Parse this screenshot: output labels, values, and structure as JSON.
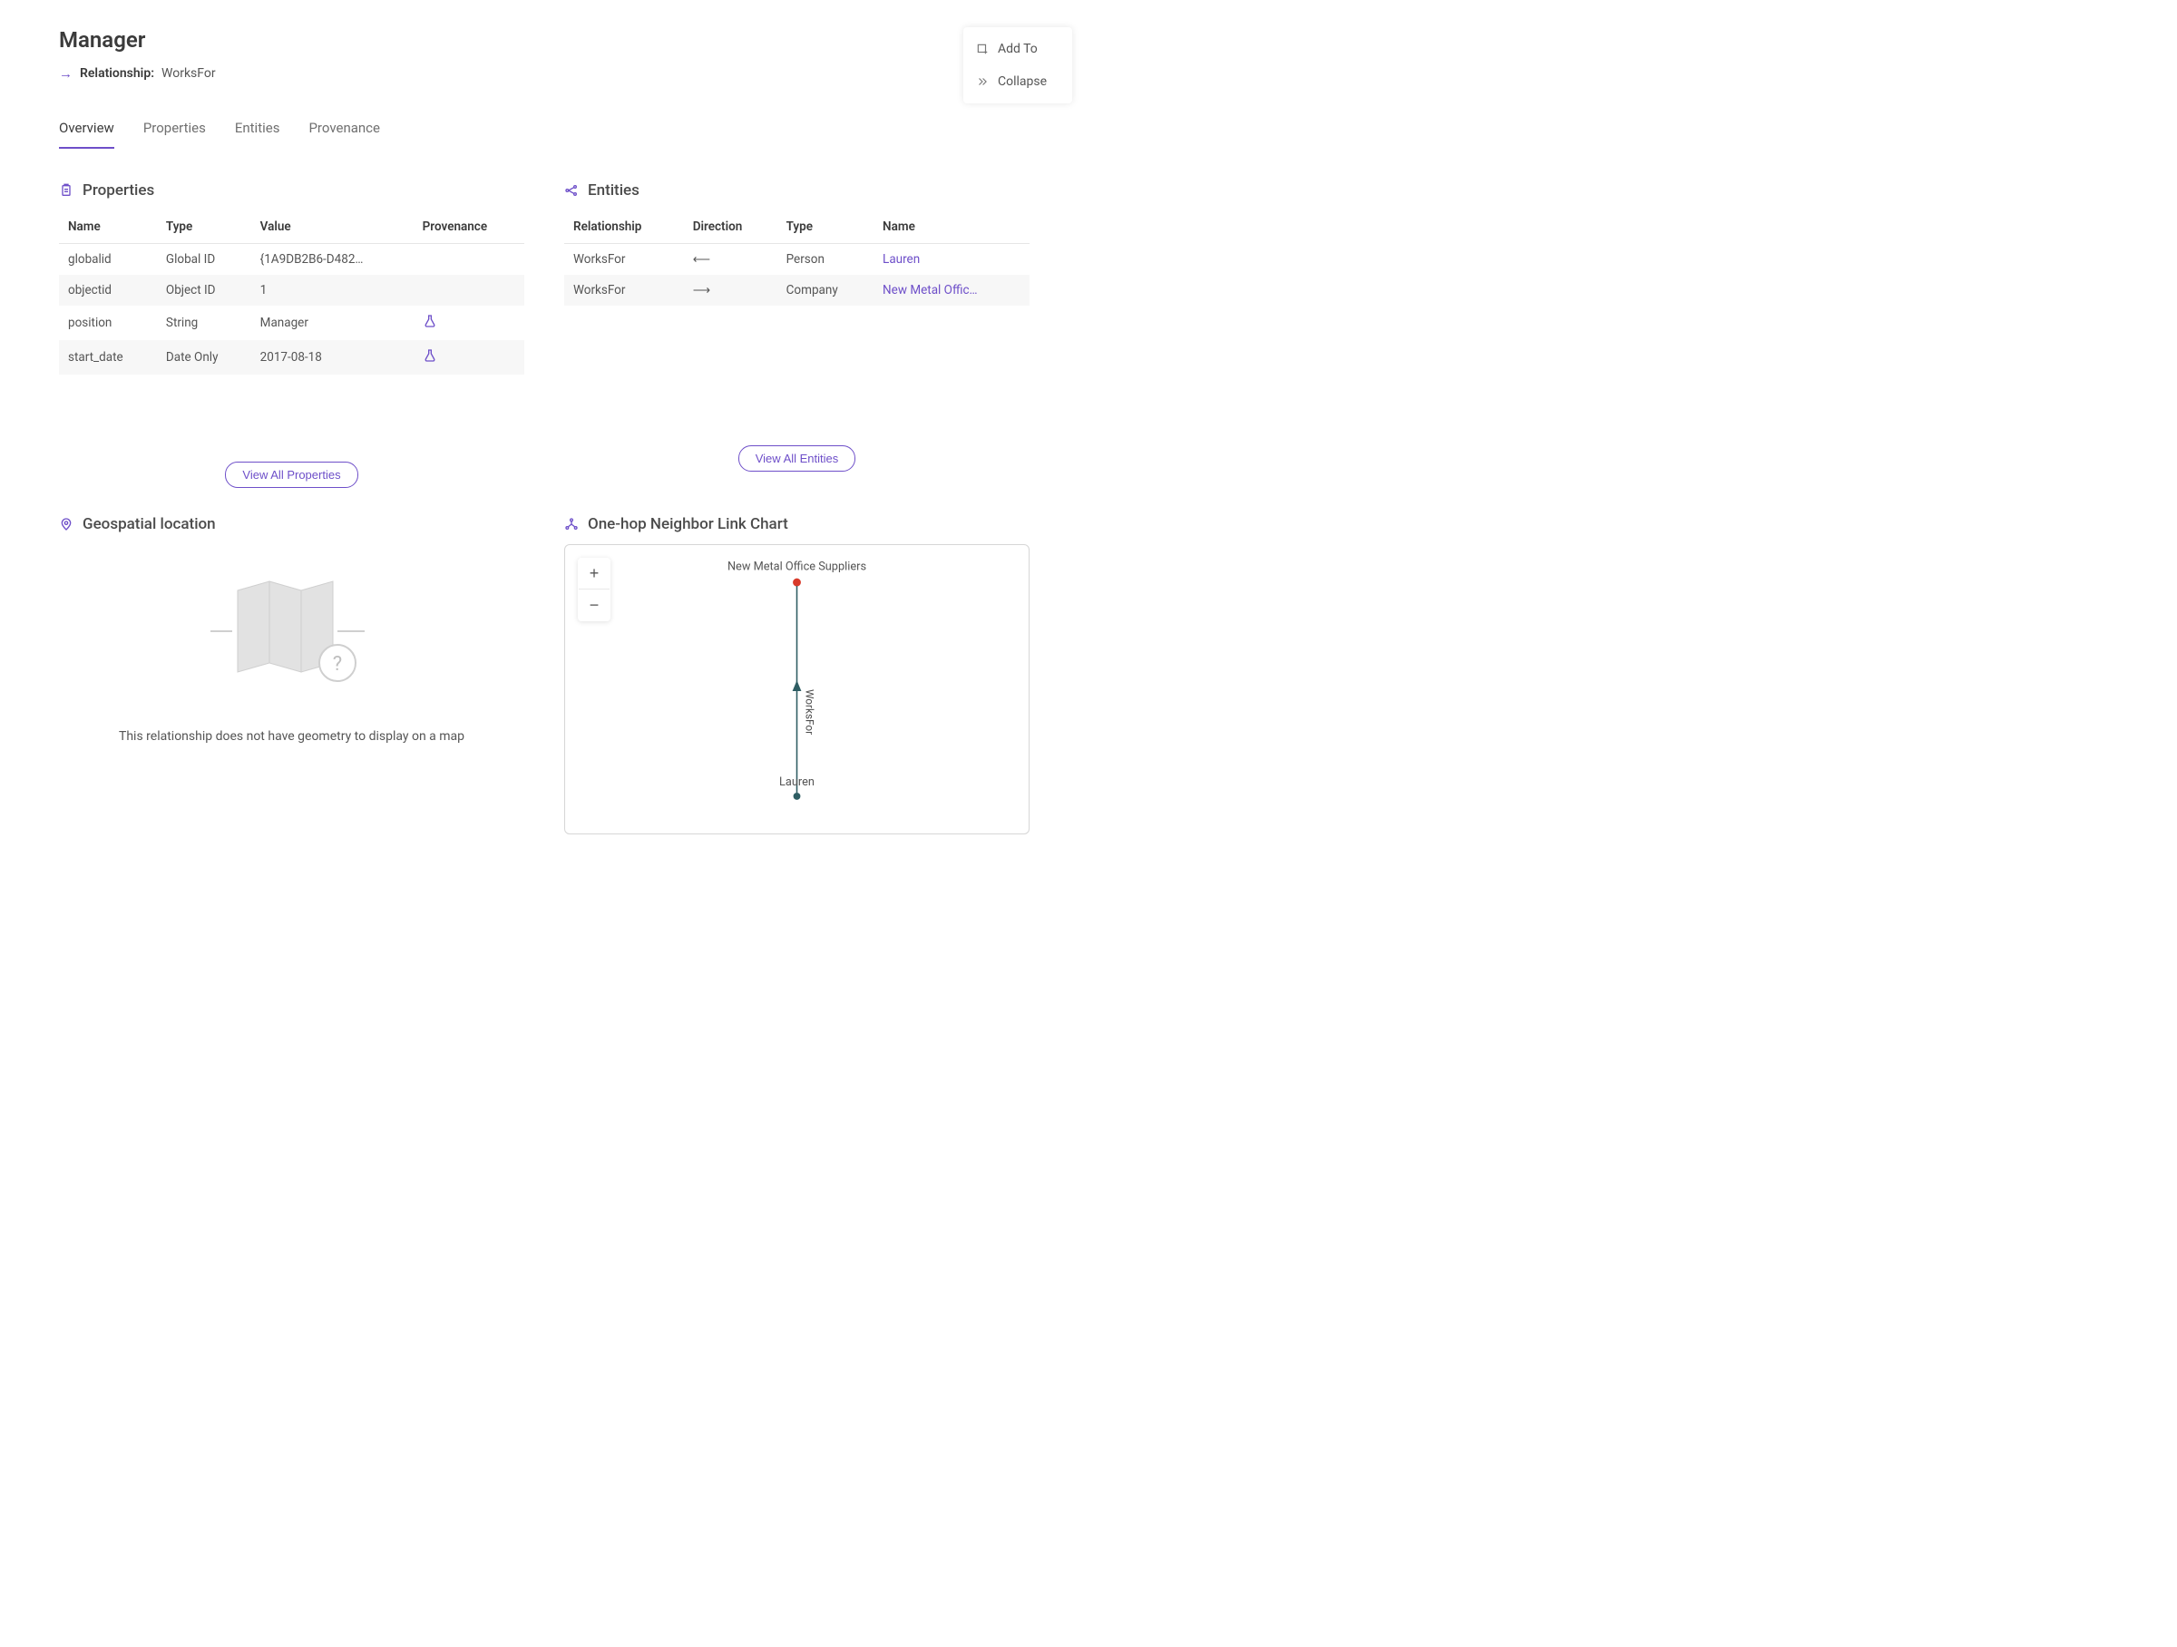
{
  "header": {
    "title": "Manager",
    "relationship_label": "Relationship:",
    "relationship_value": "WorksFor"
  },
  "float_menu": {
    "add_to": "Add To",
    "collapse": "Collapse"
  },
  "tabs": [
    {
      "label": "Overview",
      "active": true
    },
    {
      "label": "Properties",
      "active": false
    },
    {
      "label": "Entities",
      "active": false
    },
    {
      "label": "Provenance",
      "active": false
    }
  ],
  "sections": {
    "properties": {
      "title": "Properties",
      "columns": {
        "name": "Name",
        "type": "Type",
        "value": "Value",
        "provenance": "Provenance"
      },
      "rows": [
        {
          "name": "globalid",
          "type": "Global ID",
          "value": "{1A9DB2B6-D482…",
          "has_provenance": false
        },
        {
          "name": "objectid",
          "type": "Object ID",
          "value": "1",
          "has_provenance": false
        },
        {
          "name": "position",
          "type": "String",
          "value": "Manager",
          "has_provenance": true
        },
        {
          "name": "start_date",
          "type": "Date Only",
          "value": "2017-08-18",
          "has_provenance": true
        }
      ],
      "view_all": "View All Properties"
    },
    "entities": {
      "title": "Entities",
      "columns": {
        "relationship": "Relationship",
        "direction": "Direction",
        "type": "Type",
        "name": "Name"
      },
      "rows": [
        {
          "relationship": "WorksFor",
          "direction": "left",
          "type": "Person",
          "name": "Lauren"
        },
        {
          "relationship": "WorksFor",
          "direction": "right",
          "type": "Company",
          "name": "New Metal Offic…"
        }
      ],
      "view_all": "View All Entities"
    },
    "geo": {
      "title": "Geospatial location",
      "message": "This relationship does not have geometry to display on a map"
    },
    "linkchart": {
      "title": "One-hop Neighbor Link Chart",
      "nodes": {
        "top": "New Metal Office Suppliers",
        "bottom": "Lauren"
      },
      "edge_label": "WorksFor",
      "zoom_in_label": "+",
      "zoom_out_label": "−"
    }
  },
  "colors": {
    "accent": "#6e4fc9"
  }
}
